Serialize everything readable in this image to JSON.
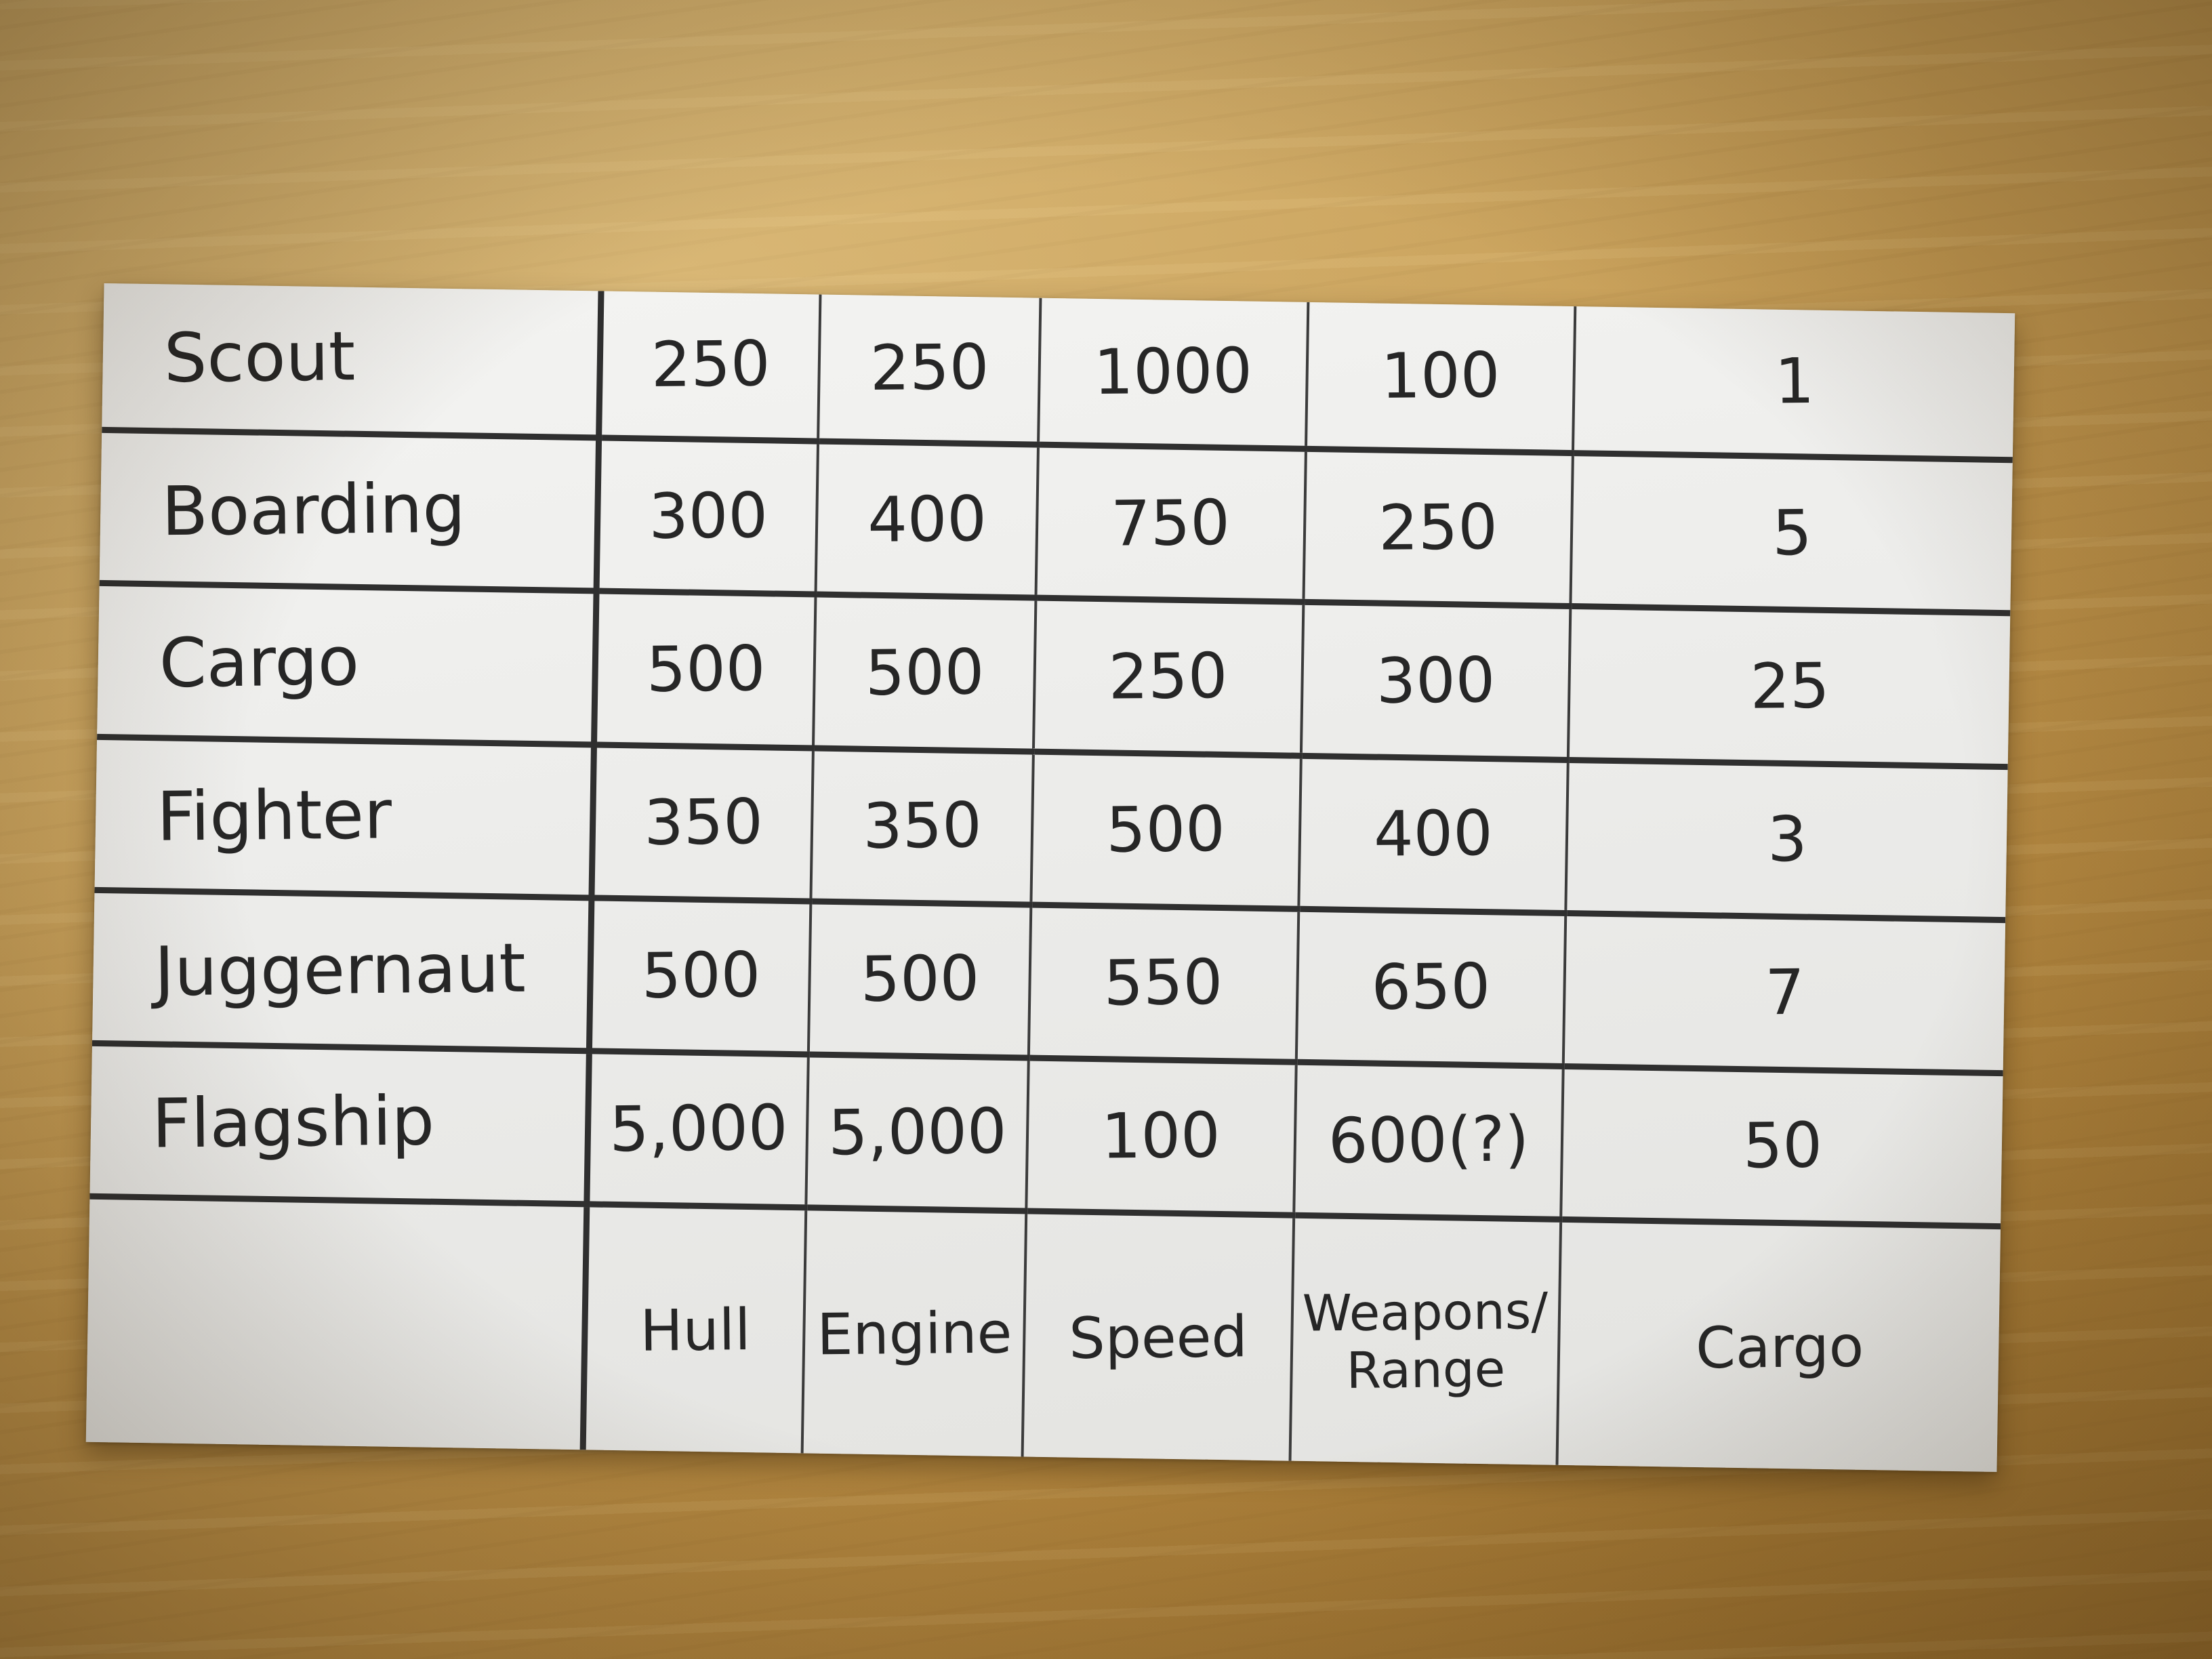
{
  "card": {
    "rows": [
      {
        "name": "Scout",
        "hull": "250",
        "engine": "250",
        "speed": "1000",
        "weapons_range": "100",
        "cargo": "1"
      },
      {
        "name": "Boarding",
        "hull": "300",
        "engine": "400",
        "speed": "750",
        "weapons_range": "250",
        "cargo": "5"
      },
      {
        "name": "Cargo",
        "hull": "500",
        "engine": "500",
        "speed": "250",
        "weapons_range": "300",
        "cargo": "25"
      },
      {
        "name": "Fighter",
        "hull": "350",
        "engine": "350",
        "speed": "500",
        "weapons_range": "400",
        "cargo": "3"
      },
      {
        "name": "Juggernaut",
        "hull": "500",
        "engine": "500",
        "speed": "550",
        "weapons_range": "650",
        "cargo": "7"
      },
      {
        "name": "Flagship",
        "hull": "5,000",
        "engine": "5,000",
        "speed": "100",
        "weapons_range": "600(?)",
        "cargo": "50"
      }
    ],
    "headers": {
      "hull": "Hull",
      "engine": "Engine",
      "speed": "Speed",
      "weapons_line1": "Weapons/",
      "weapons_line2": "Range",
      "cargo": "Cargo"
    }
  }
}
